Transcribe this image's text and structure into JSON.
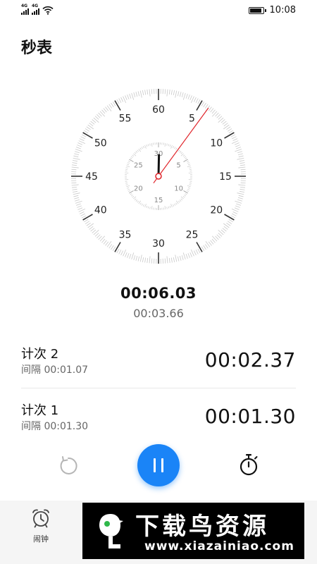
{
  "status_bar": {
    "sim1_tag": "4G",
    "sim2_tag": "4G",
    "time": "10:08"
  },
  "page": {
    "title": "秒表"
  },
  "dial": {
    "outer_labels": [
      "60",
      "5",
      "10",
      "15",
      "20",
      "25",
      "30",
      "35",
      "40",
      "45",
      "50",
      "55"
    ],
    "inner_labels": [
      "30",
      "5",
      "10",
      "15",
      "20",
      "25"
    ],
    "seconds_value": 6.03,
    "minutes_value": 0.1,
    "accent_color": "#e0242a"
  },
  "timer": {
    "main": "00:06.03",
    "current_lap": "00:03.66"
  },
  "laps": [
    {
      "title": "计次 2",
      "interval": "间隔 00:01.07",
      "time": "00:02.37"
    },
    {
      "title": "计次 1",
      "interval": "间隔 00:01.30",
      "time": "00:01.30"
    }
  ],
  "controls": {
    "reset_icon": "reset-icon",
    "pause_icon": "pause-icon",
    "lap_icon": "stopwatch-icon",
    "pause_color": "#1a84f7"
  },
  "bottom_nav": {
    "alarm_label": "闹钟",
    "alarm_icon": "alarm-clock-icon"
  },
  "watermark": {
    "title": "下载鸟资源",
    "url": "www.xiazainiao.com"
  }
}
